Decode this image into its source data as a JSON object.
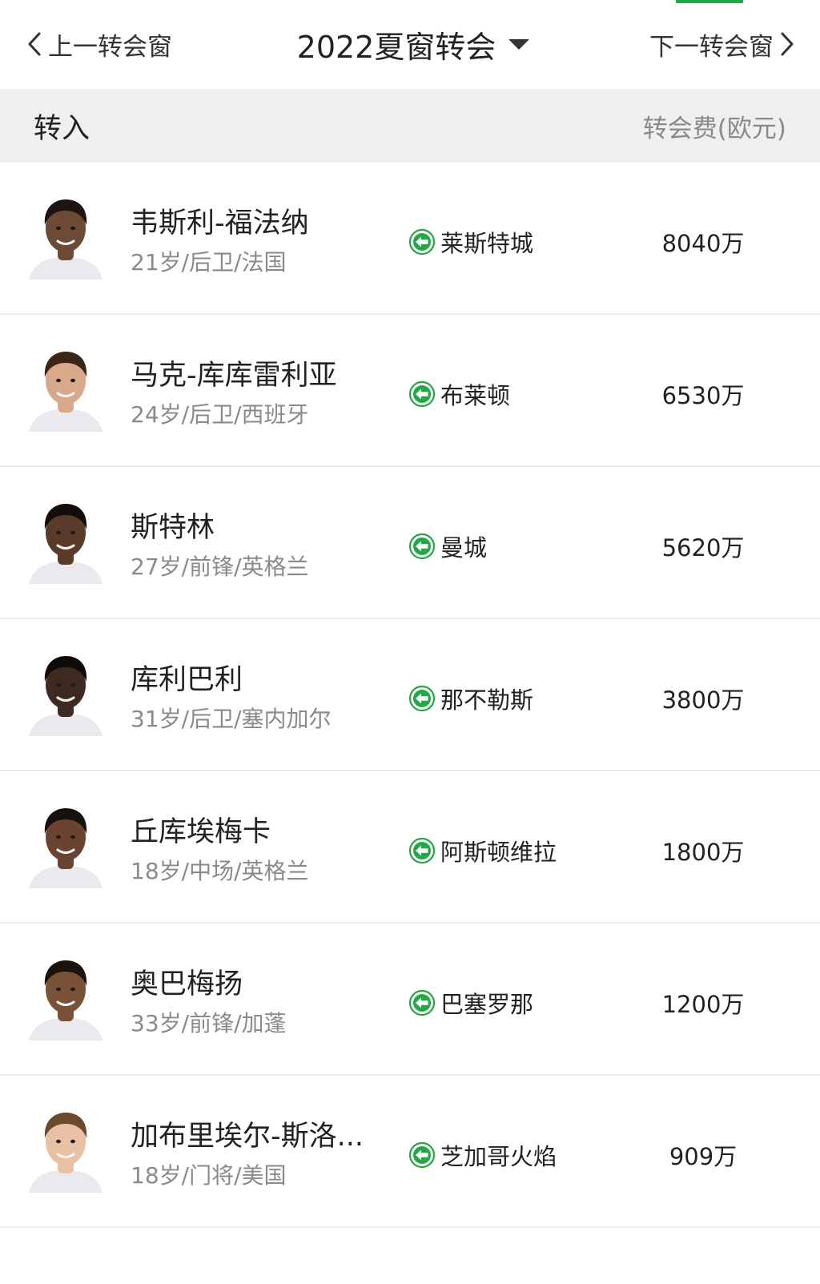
{
  "header": {
    "prev_label": "上一转会窗",
    "title": "2022夏窗转会",
    "next_label": "下一转会窗",
    "accent_color": "#1fa84a"
  },
  "section": {
    "title": "转入",
    "fee_column": "转会费(欧元)"
  },
  "players": [
    {
      "name": "韦斯利-福法纳",
      "meta": "21岁/后卫/法国",
      "club": "莱斯特城",
      "fee": "8040万"
    },
    {
      "name": "马克-库库雷利亚",
      "meta": "24岁/后卫/西班牙",
      "club": "布莱顿",
      "fee": "6530万"
    },
    {
      "name": "斯特林",
      "meta": "27岁/前锋/英格兰",
      "club": "曼城",
      "fee": "5620万"
    },
    {
      "name": "库利巴利",
      "meta": "31岁/后卫/塞内加尔",
      "club": "那不勒斯",
      "fee": "3800万"
    },
    {
      "name": "丘库埃梅卡",
      "meta": "18岁/中场/英格兰",
      "club": "阿斯顿维拉",
      "fee": "1800万"
    },
    {
      "name": "奥巴梅扬",
      "meta": "33岁/前锋/加蓬",
      "club": "巴塞罗那",
      "fee": "1200万"
    },
    {
      "name": "加布里埃尔-斯洛...",
      "meta": "18岁/门将/美国",
      "club": "芝加哥火焰",
      "fee": "909万"
    }
  ],
  "icons": {
    "prev": "chevron-left-icon",
    "next": "chevron-right-icon",
    "dropdown": "caret-down-icon",
    "incoming": "arrow-left-circle-icon",
    "avatar": "player-photo"
  },
  "colors": {
    "incoming_arrow": "#22a845",
    "header_bg": "#efefef",
    "secondary_text": "#8a8a8a"
  }
}
